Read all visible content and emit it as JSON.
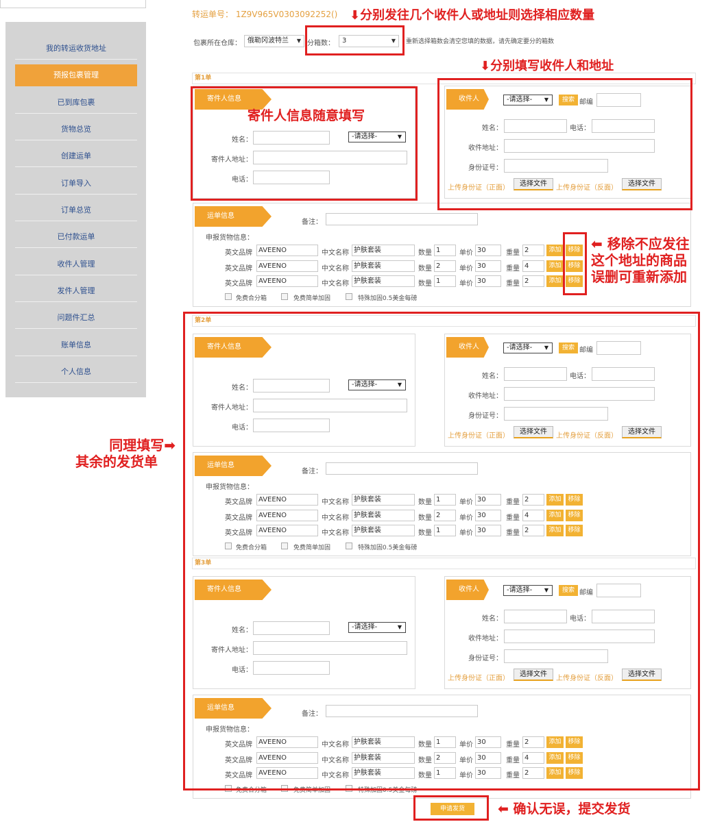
{
  "sidebar": {
    "items": [
      {
        "label": "我的转运收货地址"
      },
      {
        "label": "预报包裹管理"
      },
      {
        "label": "已到库包裹"
      },
      {
        "label": "货物总览"
      },
      {
        "label": "创建运单"
      },
      {
        "label": "订单导入"
      },
      {
        "label": "订单总览"
      },
      {
        "label": "已付款运单"
      },
      {
        "label": "收件人管理"
      },
      {
        "label": "发件人管理"
      },
      {
        "label": "问题件汇总"
      },
      {
        "label": "账单信息"
      },
      {
        "label": "个人信息"
      }
    ],
    "active_index": 1
  },
  "header": {
    "order_no": "转运单号：  1Z9V965V0303092252()",
    "warehouse_label": "包裹所在仓库：",
    "warehouse_value": "俄勒冈波特兰",
    "box_count_label": "分箱数：",
    "box_count_value": "3",
    "hint": "重新选择箱数会清空您填的数据，请先确定要分的箱数"
  },
  "annotations": {
    "box_count": "分别发往几个收件人或地址则选择相应数量",
    "recipient": "分别填写收件人和地址",
    "sender": "寄件人信息随意填写",
    "remove": [
      "移除不应发往",
      "这个地址的商品",
      "误删可重新添加"
    ],
    "same": [
      "同理填写",
      "其余的发货单"
    ],
    "submit": "确认无误，提交发货"
  },
  "labels": {
    "sender_tag": "寄件人信息",
    "recipient_tag": "收件人",
    "waybill_tag": "运单信息",
    "name": "姓名：",
    "sender_address": "寄件人地址：",
    "phone": "电话：",
    "please_select": "-请选择-",
    "search": "搜索",
    "zip": "邮编",
    "recv_address": "收件地址：",
    "id_no": "身份证号：",
    "upload_front": "上传身份证（正面）",
    "upload_back": "上传身份证（反面）",
    "choose_file": "选择文件",
    "remark": "备注：",
    "declare": "申报货物信息：",
    "en_brand": "英文品牌",
    "cn_name": "中文名称",
    "qty": "数量",
    "price": "单价",
    "weight": "重量",
    "add": "添加",
    "remove": "移除",
    "opt1": "免费合分箱",
    "opt2": "免费简单加固",
    "opt3": "特殊加固0.5美金每磅"
  },
  "orders": [
    {
      "title": "第1单"
    },
    {
      "title": "第2单"
    },
    {
      "title": "第3单"
    }
  ],
  "goods": [
    {
      "brand": "AVEENO",
      "cn": "护肤套装",
      "qty": "1",
      "price": "30",
      "weight": "2"
    },
    {
      "brand": "AVEENO",
      "cn": "护肤套装",
      "qty": "2",
      "price": "30",
      "weight": "4"
    },
    {
      "brand": "AVEENO",
      "cn": "护肤套装",
      "qty": "1",
      "price": "30",
      "weight": "2"
    }
  ],
  "submit_label": "申请发货",
  "colors": {
    "accent": "#f2a32d",
    "annotation": "#e02020",
    "link": "#2d4f8e"
  }
}
